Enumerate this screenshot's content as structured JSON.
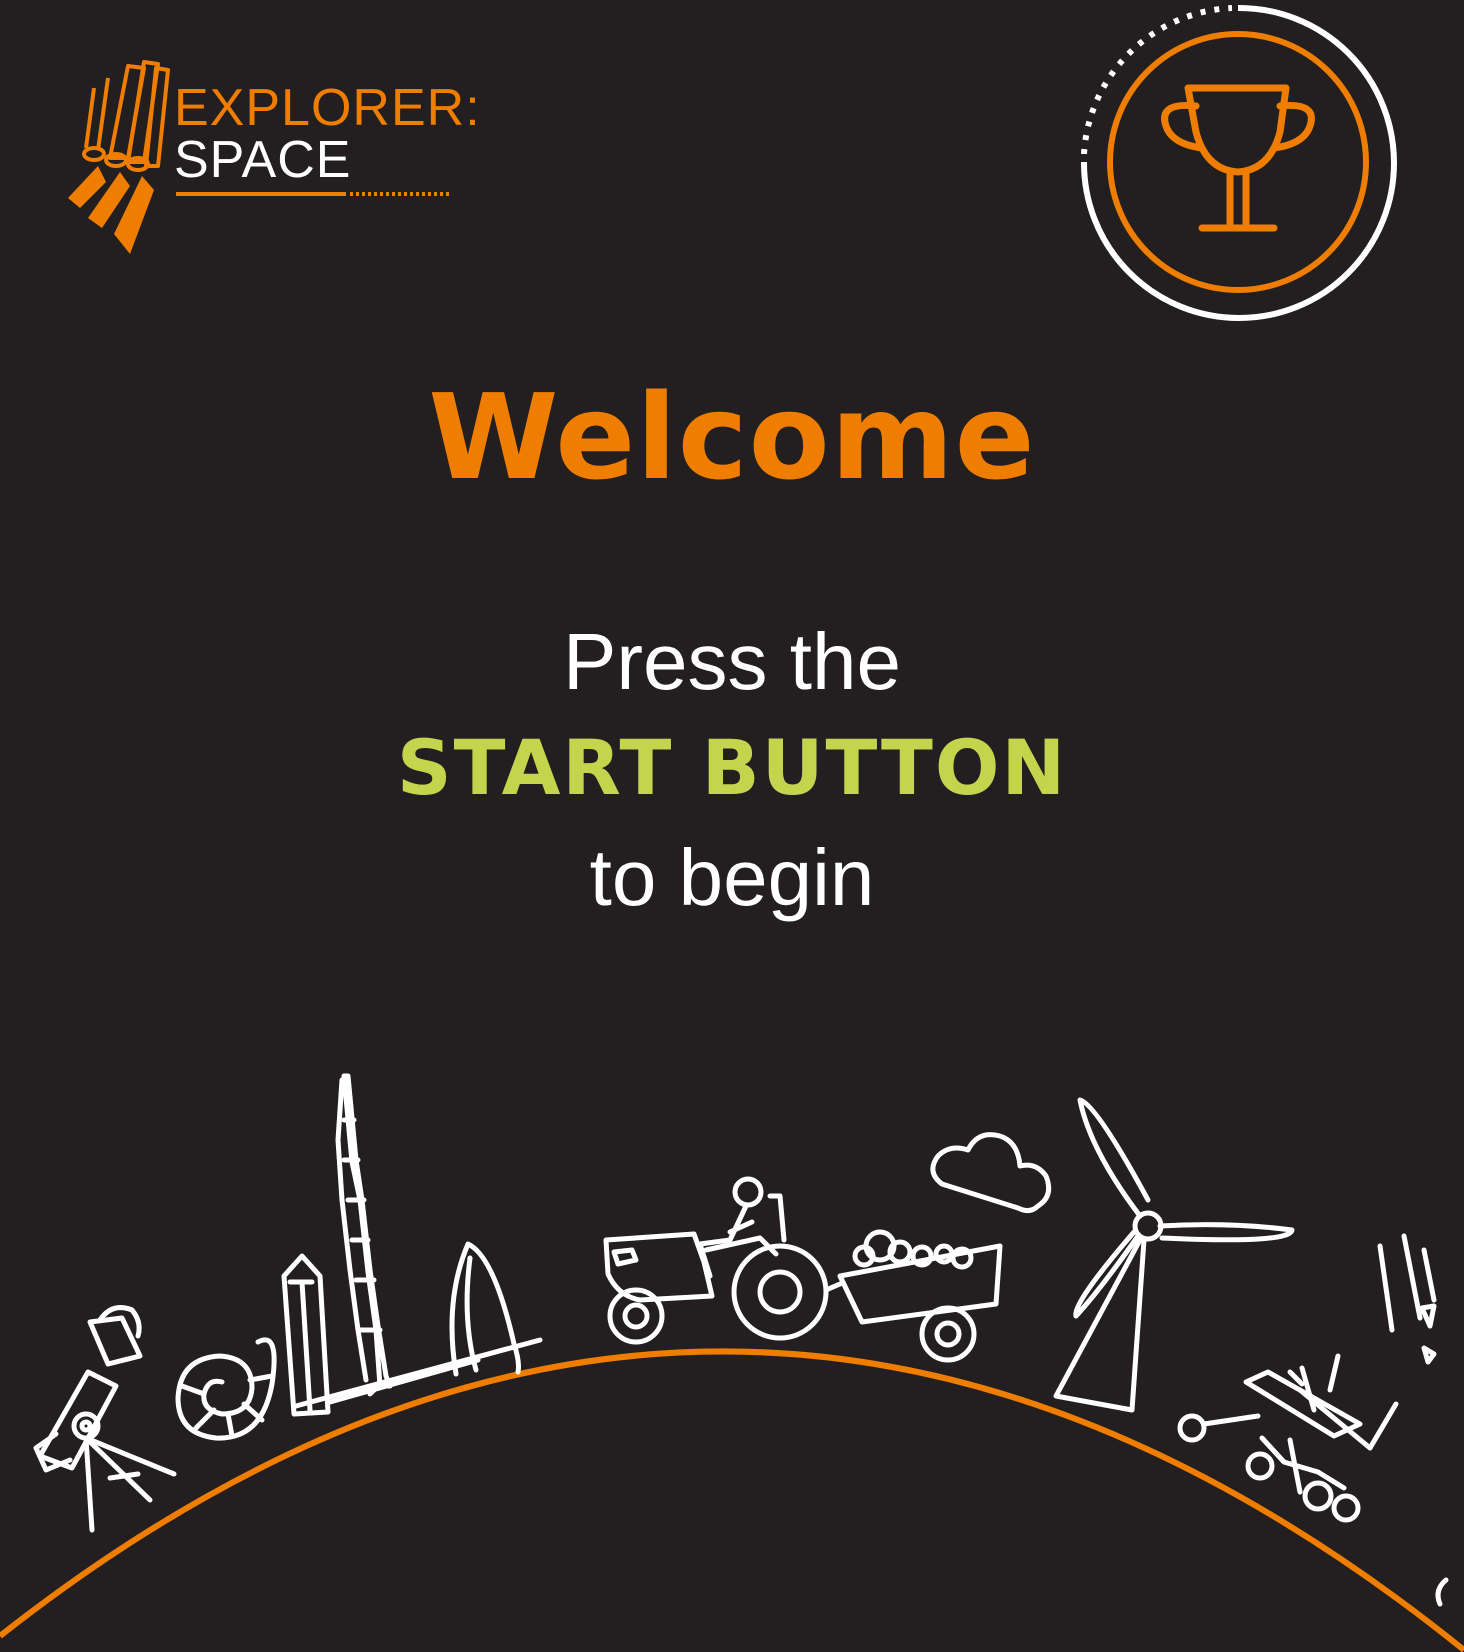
{
  "logo": {
    "word_1": "EXPLORER:",
    "word_2": "SPACE"
  },
  "welcome": {
    "title": "Welcome",
    "line_1": "Press the",
    "line_2": "START BUTTON",
    "line_3": "to begin"
  },
  "icons": {
    "logo": "rocket-icon",
    "trophy": "trophy-icon",
    "scene": [
      "telescope-icon",
      "shell-icon",
      "skyscraper-icon",
      "tractor-icon",
      "cloud-icon",
      "wind-turbine-icon",
      "rover-icon",
      "comet-icon"
    ]
  },
  "colors": {
    "background": "#231f20",
    "orange": "#ef7d00",
    "lime": "#c4d54d",
    "white": "#ffffff"
  }
}
